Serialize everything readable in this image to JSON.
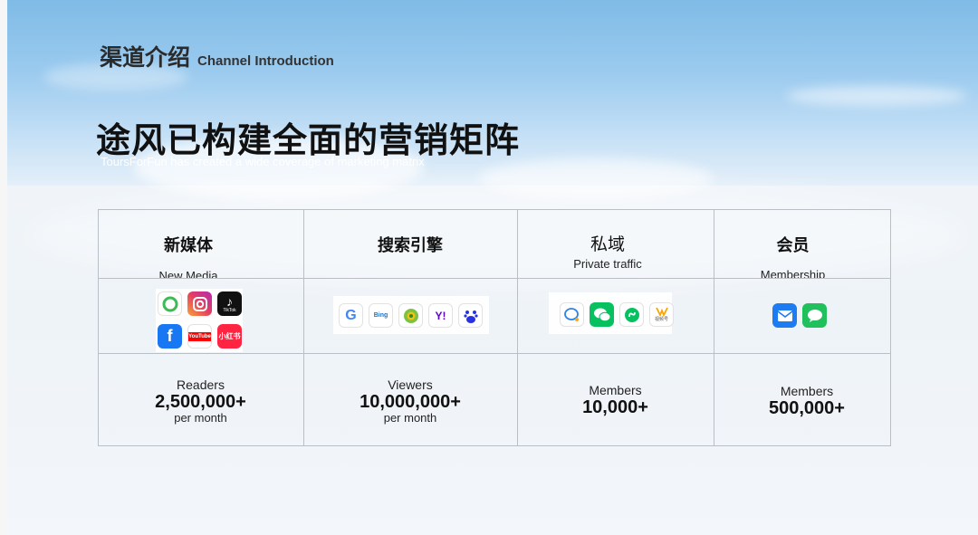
{
  "header": {
    "title_cn": "渠道介绍",
    "title_en": "Channel Introduction"
  },
  "hero": {
    "title": "途风已构建全面的营销矩阵",
    "subtitle": "ToursForFun has created a wide coverage of marketing matrix"
  },
  "columns": [
    {
      "title_cn": "新媒体",
      "title_en": "New Media",
      "icons": [
        "wechat-moments-icon",
        "instagram-icon",
        "tiktok-icon",
        "facebook-icon",
        "youtube-icon",
        "xiaohongshu-icon"
      ],
      "icon_labels": {
        "tiktok": "TikTok",
        "youtube": "YouTube",
        "xiaohongshu": "小红书"
      },
      "stat_label": "Readers",
      "stat_value": "2,500,000+",
      "stat_unit": "per month"
    },
    {
      "title_cn": "搜索引擎",
      "title_en": "",
      "icons": [
        "google-icon",
        "bing-icon",
        "360-search-icon",
        "yahoo-icon",
        "baidu-icon"
      ],
      "icon_labels": {
        "google": "G",
        "bing": "Bing",
        "yahoo": "Y!"
      },
      "stat_label": "Viewers",
      "stat_value": "10,000,000+",
      "stat_unit": "per month"
    },
    {
      "title_cn": "私域",
      "title_en": "Private traffic",
      "icons": [
        "wecom-icon",
        "wechat-icon",
        "mini-program-icon",
        "wechat-channels-icon"
      ],
      "icon_labels": {
        "channels": "视频号"
      },
      "stat_label": "Members",
      "stat_value": "10,000+",
      "stat_unit": ""
    },
    {
      "title_cn": "会员",
      "title_en": "Membership",
      "icons": [
        "email-icon",
        "sms-icon"
      ],
      "stat_label": "Members",
      "stat_value": "500,000+",
      "stat_unit": ""
    }
  ],
  "colors": {
    "grid_line": "#b9bfc6",
    "instagram": "#d6249f",
    "tiktok": "#111111",
    "facebook": "#1877f2",
    "youtube": "#ff0000",
    "xiaohongshu": "#ff2442",
    "wechat": "#07c160",
    "email": "#1e7cf2",
    "sms": "#20c05c"
  }
}
